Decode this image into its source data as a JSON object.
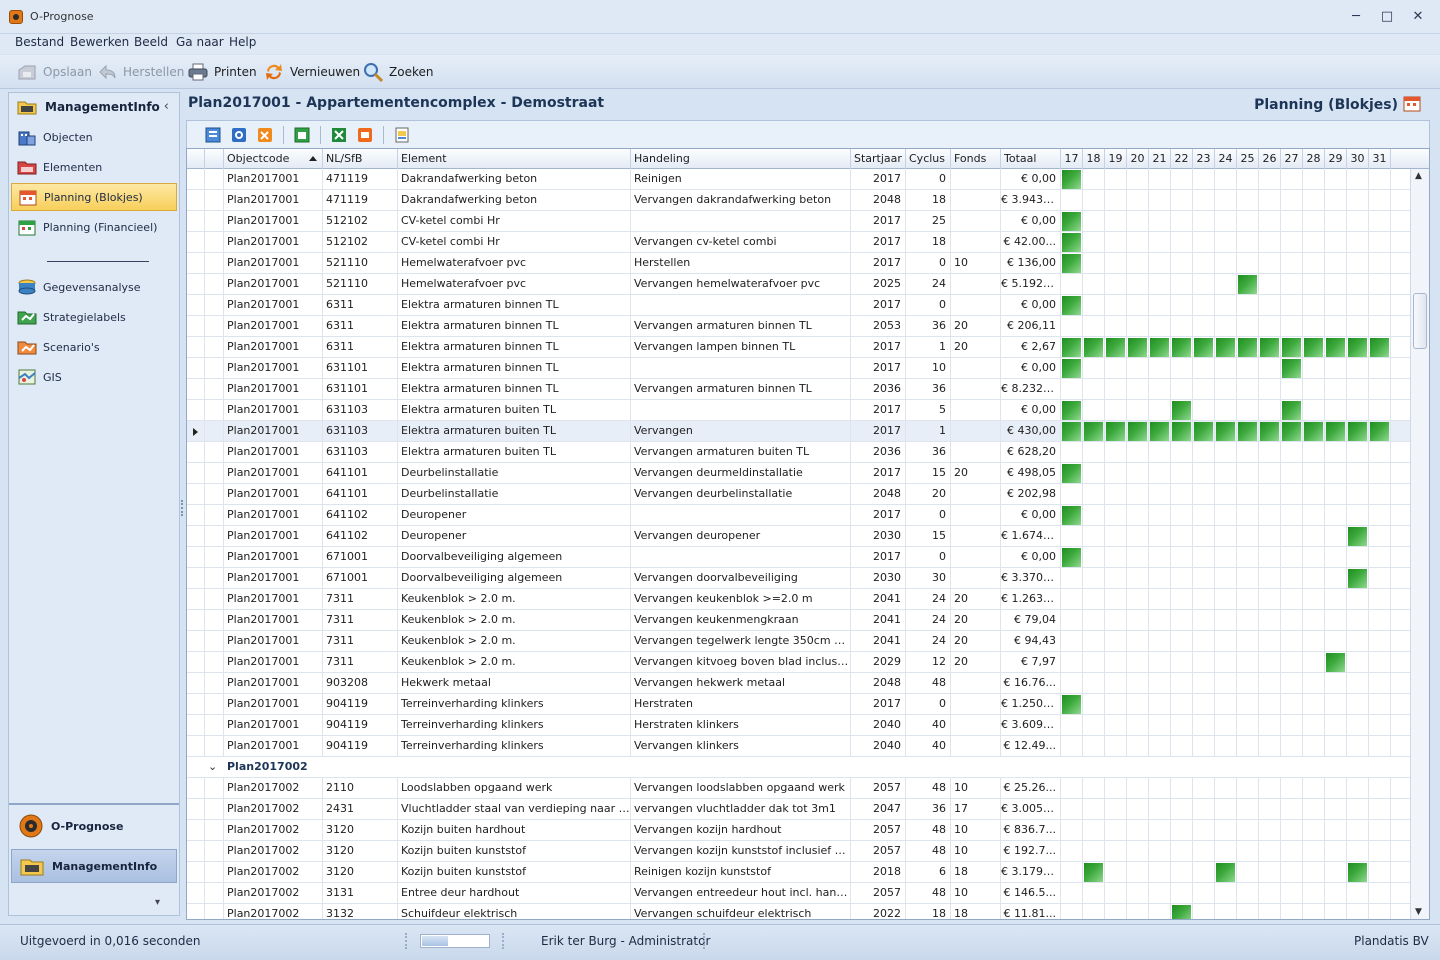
{
  "window": {
    "title": "O-Prognose",
    "minimize": "─",
    "maximize": "□",
    "close": "✕"
  },
  "menu": [
    "Bestand",
    "Bewerken",
    "Beeld",
    "Ga naar",
    "Help"
  ],
  "toolbar": {
    "save": "Opslaan",
    "restore": "Herstellen",
    "print": "Printen",
    "refresh": "Vernieuwen",
    "search": "Zoeken"
  },
  "sidebar": {
    "header": "ManagementInfo",
    "collapse": "‹",
    "items": [
      "Objecten",
      "Elementen",
      "Planning (Blokjes)",
      "Planning (Financieel)"
    ],
    "items2": [
      "Gegevensanalyse",
      "Strategielabels",
      "Scenario's",
      "GIS"
    ],
    "nav": [
      "O-Prognose",
      "ManagementInfo"
    ],
    "more": "▾"
  },
  "main": {
    "title": "Plan2017001 - Appartementencomplex - Demostraat",
    "view_title": "Planning (Blokjes)"
  },
  "grid": {
    "columns": [
      "Objectcode",
      "NL/SfB",
      "Element",
      "Handeling",
      "Startjaar",
      "Cyclus",
      "Fonds",
      "Totaal"
    ],
    "days": [
      "17",
      "18",
      "19",
      "20",
      "21",
      "22",
      "23",
      "24",
      "25",
      "26",
      "27",
      "28",
      "29",
      "30",
      "31"
    ],
    "block_color": "#2e9b2e",
    "rows": [
      {
        "code": "Plan2017001",
        "sfb": "471119",
        "element": "Dakrandafwerking beton",
        "handeling": "Reinigen",
        "start": "2017",
        "cyclus": "0",
        "fonds": "",
        "totaal": "€ 0,00",
        "blocks": [
          17
        ]
      },
      {
        "code": "Plan2017001",
        "sfb": "471119",
        "element": "Dakrandafwerking beton",
        "handeling": "Vervangen dakrandafwerking beton",
        "start": "2048",
        "cyclus": "18",
        "fonds": "",
        "totaal": "€ 3.943....",
        "blocks": []
      },
      {
        "code": "Plan2017001",
        "sfb": "512102",
        "element": "CV-ketel combi Hr",
        "handeling": "",
        "start": "2017",
        "cyclus": "25",
        "fonds": "",
        "totaal": "€ 0,00",
        "blocks": [
          17
        ]
      },
      {
        "code": "Plan2017001",
        "sfb": "512102",
        "element": "CV-ketel combi Hr",
        "handeling": "Vervangen cv-ketel combi",
        "start": "2017",
        "cyclus": "18",
        "fonds": "",
        "totaal": "€ 42.00...",
        "blocks": [
          17
        ]
      },
      {
        "code": "Plan2017001",
        "sfb": "521110",
        "element": "Hemelwaterafvoer pvc",
        "handeling": "Herstellen",
        "start": "2017",
        "cyclus": "0",
        "fonds": "10",
        "totaal": "€ 136,00",
        "blocks": [
          17
        ]
      },
      {
        "code": "Plan2017001",
        "sfb": "521110",
        "element": "Hemelwaterafvoer pvc",
        "handeling": "Vervangen hemelwaterafvoer pvc",
        "start": "2025",
        "cyclus": "24",
        "fonds": "",
        "totaal": "€ 5.192....",
        "blocks": [
          25
        ]
      },
      {
        "code": "Plan2017001",
        "sfb": "6311",
        "element": "Elektra armaturen binnen TL",
        "handeling": "",
        "start": "2017",
        "cyclus": "0",
        "fonds": "",
        "totaal": "€ 0,00",
        "blocks": [
          17
        ]
      },
      {
        "code": "Plan2017001",
        "sfb": "6311",
        "element": "Elektra armaturen binnen TL",
        "handeling": "Vervangen armaturen binnen TL",
        "start": "2053",
        "cyclus": "36",
        "fonds": "20",
        "totaal": "€ 206,11",
        "blocks": []
      },
      {
        "code": "Plan2017001",
        "sfb": "6311",
        "element": "Elektra armaturen binnen TL",
        "handeling": "Vervangen lampen binnen TL",
        "start": "2017",
        "cyclus": "1",
        "fonds": "20",
        "totaal": "€ 2,67",
        "blocks": [
          17,
          18,
          19,
          20,
          21,
          22,
          23,
          24,
          25,
          26,
          27,
          28,
          29,
          30,
          31
        ]
      },
      {
        "code": "Plan2017001",
        "sfb": "631101",
        "element": "Elektra armaturen binnen TL",
        "handeling": "",
        "start": "2017",
        "cyclus": "10",
        "fonds": "",
        "totaal": "€ 0,00",
        "blocks": [
          17,
          27
        ]
      },
      {
        "code": "Plan2017001",
        "sfb": "631101",
        "element": "Elektra armaturen binnen TL",
        "handeling": "Vervangen armaturen binnen TL",
        "start": "2036",
        "cyclus": "36",
        "fonds": "",
        "totaal": "€ 8.232....",
        "blocks": []
      },
      {
        "code": "Plan2017001",
        "sfb": "631103",
        "element": "Elektra armaturen buiten TL",
        "handeling": "",
        "start": "2017",
        "cyclus": "5",
        "fonds": "",
        "totaal": "€ 0,00",
        "blocks": [
          17,
          22,
          27
        ]
      },
      {
        "code": "Plan2017001",
        "sfb": "631103",
        "element": "Elektra armaturen buiten TL",
        "handeling": "Vervangen",
        "start": "2017",
        "cyclus": "1",
        "fonds": "",
        "totaal": "€ 430,00",
        "blocks": [
          17,
          18,
          19,
          20,
          21,
          22,
          23,
          24,
          25,
          26,
          27,
          28,
          29,
          30,
          31
        ],
        "selected": true
      },
      {
        "code": "Plan2017001",
        "sfb": "631103",
        "element": "Elektra armaturen buiten TL",
        "handeling": "Vervangen armaturen buiten TL",
        "start": "2036",
        "cyclus": "36",
        "fonds": "",
        "totaal": "€ 628,20",
        "blocks": []
      },
      {
        "code": "Plan2017001",
        "sfb": "641101",
        "element": "Deurbelinstallatie",
        "handeling": "Vervangen deurmeldinstallatie",
        "start": "2017",
        "cyclus": "15",
        "fonds": "20",
        "totaal": "€ 498,05",
        "blocks": [
          17
        ]
      },
      {
        "code": "Plan2017001",
        "sfb": "641101",
        "element": "Deurbelinstallatie",
        "handeling": "Vervangen deurbelinstallatie",
        "start": "2048",
        "cyclus": "20",
        "fonds": "",
        "totaal": "€ 202,98",
        "blocks": []
      },
      {
        "code": "Plan2017001",
        "sfb": "641102",
        "element": "Deuropener",
        "handeling": "",
        "start": "2017",
        "cyclus": "0",
        "fonds": "",
        "totaal": "€ 0,00",
        "blocks": [
          17
        ]
      },
      {
        "code": "Plan2017001",
        "sfb": "641102",
        "element": "Deuropener",
        "handeling": "Vervangen deuropener",
        "start": "2030",
        "cyclus": "15",
        "fonds": "",
        "totaal": "€ 1.674....",
        "blocks": [
          30
        ]
      },
      {
        "code": "Plan2017001",
        "sfb": "671001",
        "element": "Doorvalbeveiliging algemeen",
        "handeling": "",
        "start": "2017",
        "cyclus": "0",
        "fonds": "",
        "totaal": "€ 0,00",
        "blocks": [
          17
        ]
      },
      {
        "code": "Plan2017001",
        "sfb": "671001",
        "element": "Doorvalbeveiliging algemeen",
        "handeling": "Vervangen doorvalbeveiliging",
        "start": "2030",
        "cyclus": "30",
        "fonds": "",
        "totaal": "€ 3.370....",
        "blocks": [
          30
        ]
      },
      {
        "code": "Plan2017001",
        "sfb": "7311",
        "element": "Keukenblok > 2.0 m.",
        "handeling": "Vervangen keukenblok  >=2.0 m",
        "start": "2041",
        "cyclus": "24",
        "fonds": "20",
        "totaal": "€ 1.263....",
        "blocks": []
      },
      {
        "code": "Plan2017001",
        "sfb": "7311",
        "element": "Keukenblok > 2.0 m.",
        "handeling": "Vervangen keukenmengkraan",
        "start": "2041",
        "cyclus": "24",
        "fonds": "20",
        "totaal": "€ 79,04",
        "blocks": []
      },
      {
        "code": "Plan2017001",
        "sfb": "7311",
        "element": "Keukenblok > 2.0 m.",
        "handeling": "Vervangen tegelwerk lengte 350cm hoogte...",
        "start": "2041",
        "cyclus": "24",
        "fonds": "20",
        "totaal": "€ 94,43",
        "blocks": []
      },
      {
        "code": "Plan2017001",
        "sfb": "7311",
        "element": "Keukenblok > 2.0 m.",
        "handeling": "Vervangen kitvoeg boven blad inclusief in...",
        "start": "2029",
        "cyclus": "12",
        "fonds": "20",
        "totaal": "€ 7,97",
        "blocks": [
          29
        ]
      },
      {
        "code": "Plan2017001",
        "sfb": "903208",
        "element": "Hekwerk metaal",
        "handeling": "Vervangen hekwerk metaal",
        "start": "2048",
        "cyclus": "48",
        "fonds": "",
        "totaal": "€ 16.76...",
        "blocks": []
      },
      {
        "code": "Plan2017001",
        "sfb": "904119",
        "element": "Terreinverharding klinkers",
        "handeling": "Herstraten",
        "start": "2017",
        "cyclus": "0",
        "fonds": "",
        "totaal": "€ 1.250....",
        "blocks": [
          17
        ]
      },
      {
        "code": "Plan2017001",
        "sfb": "904119",
        "element": "Terreinverharding klinkers",
        "handeling": "Herstraten klinkers",
        "start": "2040",
        "cyclus": "40",
        "fonds": "",
        "totaal": "€ 3.609....",
        "blocks": []
      },
      {
        "code": "Plan2017001",
        "sfb": "904119",
        "element": "Terreinverharding klinkers",
        "handeling": "Vervangen klinkers",
        "start": "2040",
        "cyclus": "40",
        "fonds": "",
        "totaal": "€ 12.49...",
        "blocks": []
      },
      {
        "group": "Plan2017002",
        "chevron": "⌄"
      },
      {
        "code": "Plan2017002",
        "sfb": "2110",
        "element": "Loodslabben opgaand werk",
        "handeling": "Vervangen loodslabben opgaand werk",
        "start": "2057",
        "cyclus": "48",
        "fonds": "10",
        "totaal": "€ 25.26...",
        "blocks": []
      },
      {
        "code": "Plan2017002",
        "sfb": "2431",
        "element": "Vluchtladder staal van verdieping naar dak",
        "handeling": "vervangen vluchtladder dak tot 3m1",
        "start": "2047",
        "cyclus": "36",
        "fonds": "17",
        "totaal": "€ 3.005....",
        "blocks": []
      },
      {
        "code": "Plan2017002",
        "sfb": "3120",
        "element": "Kozijn buiten hardhout",
        "handeling": "Vervangen kozijn hardhout",
        "start": "2057",
        "cyclus": "48",
        "fonds": "10",
        "totaal": "€ 836.7...",
        "blocks": []
      },
      {
        "code": "Plan2017002",
        "sfb": "3120",
        "element": "Kozijn buiten kunststof",
        "handeling": "Vervangen kozijn kunststof inclusief begla...",
        "start": "2057",
        "cyclus": "48",
        "fonds": "10",
        "totaal": "€ 192.7...",
        "blocks": []
      },
      {
        "code": "Plan2017002",
        "sfb": "3120",
        "element": "Kozijn buiten kunststof",
        "handeling": "Reinigen kozijn kunststof",
        "start": "2018",
        "cyclus": "6",
        "fonds": "18",
        "totaal": "€ 3.179....",
        "blocks": [
          18,
          24,
          30
        ]
      },
      {
        "code": "Plan2017002",
        "sfb": "3131",
        "element": "Entree deur hardhout",
        "handeling": "Vervangen entreedeur hout incl. hang&sl...",
        "start": "2057",
        "cyclus": "48",
        "fonds": "10",
        "totaal": "€ 146.5...",
        "blocks": []
      },
      {
        "code": "Plan2017002",
        "sfb": "3132",
        "element": "Schuifdeur elektrisch",
        "handeling": "Vervangen schuifdeur elektrisch",
        "start": "2022",
        "cyclus": "18",
        "fonds": "18",
        "totaal": "€ 11.81...",
        "blocks": [
          22
        ]
      }
    ]
  },
  "statusbar": {
    "executed": "Uitgevoerd in 0,016 seconden",
    "progress": 0.4,
    "user": "Erik ter Burg - Administrator",
    "company": "Plandatis BV"
  }
}
